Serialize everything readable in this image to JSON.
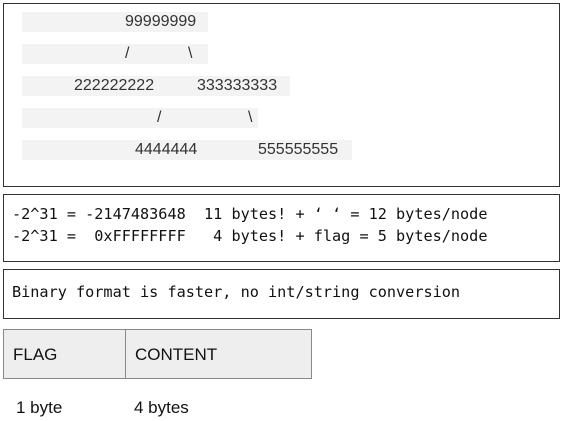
{
  "tree": {
    "root": "99999999",
    "branch1_left": "/",
    "branch1_right": "\\",
    "level2_left": "222222222",
    "level2_right": "333333333",
    "branch2_left": "/",
    "branch2_right": "\\",
    "level3_left": "4444444",
    "level3_right": "555555555"
  },
  "bytes": {
    "line1": "-2^31 = -2147483648  11 bytes! + ‘ ‘ = 12 bytes/node",
    "line2": "-2^31 =  0xFFFFFFFF   4 bytes! + flag = 5 bytes/node"
  },
  "binary": {
    "text": "Binary format is faster, no int/string conversion"
  },
  "format": {
    "flag_label": "FLAG",
    "content_label": "CONTENT",
    "flag_size": "1 byte",
    "content_size": "4 bytes"
  }
}
